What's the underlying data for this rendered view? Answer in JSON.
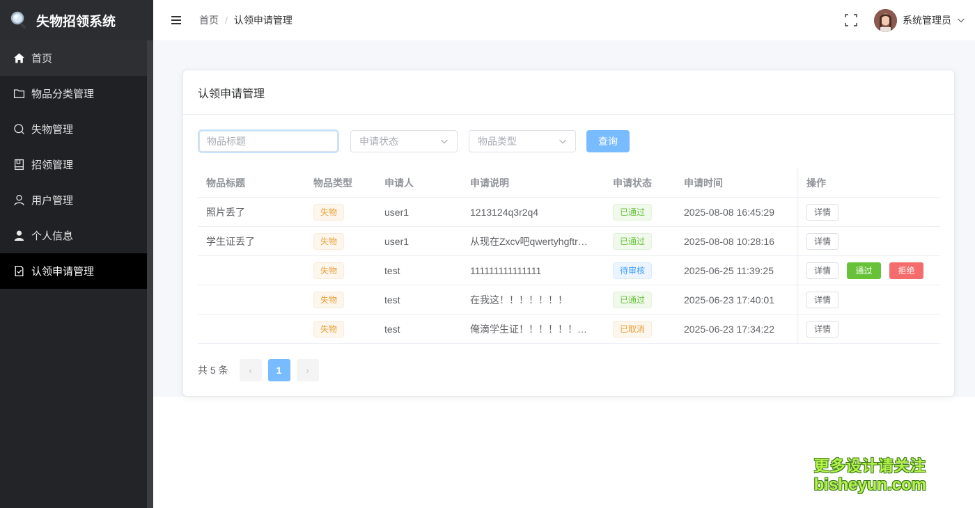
{
  "app": {
    "title": "失物招领系统"
  },
  "sidebar": {
    "items": [
      {
        "label": "首页",
        "icon": "home-icon"
      },
      {
        "label": "物品分类管理",
        "icon": "folder-icon"
      },
      {
        "label": "失物管理",
        "icon": "search-icon"
      },
      {
        "label": "招领管理",
        "icon": "notebook-icon"
      },
      {
        "label": "用户管理",
        "icon": "user-icon"
      },
      {
        "label": "个人信息",
        "icon": "user-filled-icon"
      },
      {
        "label": "认领申请管理",
        "icon": "document-check-icon",
        "active": true
      }
    ]
  },
  "header": {
    "breadcrumb": [
      "首页",
      "认领申请管理"
    ],
    "separator": "/",
    "username": "系统管理员"
  },
  "card": {
    "title": "认领申请管理"
  },
  "filters": {
    "title_placeholder": "物品标题",
    "status_placeholder": "申请状态",
    "type_placeholder": "物品类型",
    "query_label": "查询"
  },
  "table": {
    "columns": [
      "物品标题",
      "物品类型",
      "申请人",
      "申请说明",
      "申请状态",
      "申请时间",
      "操作"
    ],
    "rows": [
      {
        "title": "照片丢了",
        "type": "失物",
        "applicant": "user1",
        "desc": "1213124q3r2q4",
        "status": "已通过",
        "time": "2025-08-08 16:45:29",
        "actions": [
          "详情"
        ]
      },
      {
        "title": "学生证丢了",
        "type": "失物",
        "applicant": "user1",
        "desc": "从现在Zxcv吧qwertyhgftr…",
        "status": "已通过",
        "time": "2025-08-08 10:28:16",
        "actions": [
          "详情"
        ]
      },
      {
        "title": "",
        "type": "失物",
        "applicant": "test",
        "desc": "111111111111111",
        "status": "待审核",
        "time": "2025-06-25 11:39:25",
        "actions": [
          "详情",
          "通过",
          "拒绝"
        ]
      },
      {
        "title": "",
        "type": "失物",
        "applicant": "test",
        "desc": "在我这！！！！！！！",
        "status": "已通过",
        "time": "2025-06-23 17:40:01",
        "actions": [
          "详情"
        ]
      },
      {
        "title": "",
        "type": "失物",
        "applicant": "test",
        "desc": "俺滴学生证！！！！！！…",
        "status": "已取消",
        "time": "2025-06-23 17:34:22",
        "actions": [
          "详情"
        ]
      }
    ]
  },
  "pagination": {
    "total_label": "共 5 条",
    "current_page": "1",
    "prev": "‹",
    "next": "›"
  },
  "watermark": {
    "line1": "更多设计请关注",
    "line2": "bisheyun.com"
  },
  "colors": {
    "primary_light": "#79bbff",
    "success": "#67c23a",
    "danger": "#f56c6c",
    "warning": "#e6a23c",
    "sidebar_bg": "#222428",
    "active_bg": "#000000"
  }
}
